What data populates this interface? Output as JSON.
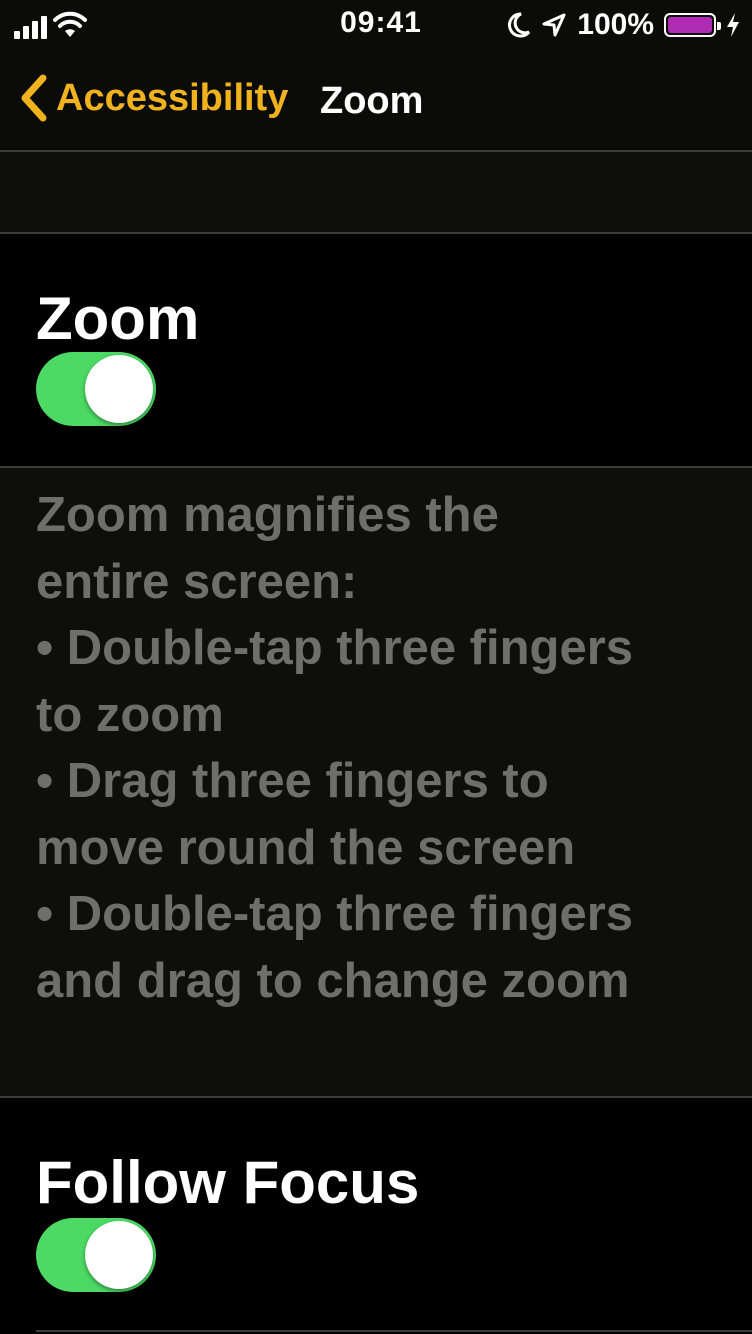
{
  "status_bar": {
    "time": "09:41",
    "battery_percent": "100%",
    "battery_color": "#b02bb3",
    "icons": [
      "signal-icon",
      "wifi-icon",
      "moon-icon",
      "location-icon",
      "battery-icon",
      "charging-icon"
    ]
  },
  "nav": {
    "back_label": "Accessibility",
    "title": "Zoom",
    "accent_color": "#f1b31d"
  },
  "zoom_cell": {
    "label": "Zoom",
    "toggle_on": true
  },
  "footer": {
    "lines": [
      "Zoom magnifies the",
      "entire screen:",
      "•  Double-tap three fingers",
      "to zoom",
      "•  Drag three fingers to",
      "move round the screen",
      "•  Double-tap three fingers",
      "and drag to change zoom"
    ]
  },
  "follow_focus_cell": {
    "label": "Follow Focus",
    "toggle_on": true
  },
  "toggle_color": "#4cd964"
}
